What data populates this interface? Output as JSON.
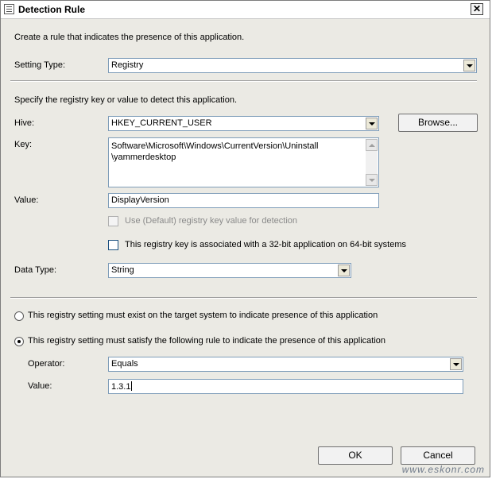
{
  "window": {
    "title": "Detection Rule"
  },
  "intro_text": "Create a rule that indicates the presence of this application.",
  "setting_type": {
    "label": "Setting Type:",
    "value": "Registry"
  },
  "registry": {
    "instruction": "Specify the registry key or value to detect this application.",
    "hive": {
      "label": "Hive:",
      "value": "HKEY_CURRENT_USER"
    },
    "browse_label": "Browse...",
    "key": {
      "label": "Key:",
      "value": "Software\\Microsoft\\Windows\\CurrentVersion\\Uninstall\n\\yammerdesktop"
    },
    "value": {
      "label": "Value:",
      "value": "DisplayVersion"
    },
    "use_default_label": "Use (Default) registry key value for detection",
    "is_32bit_label": "This registry key is associated with a 32-bit application on 64-bit systems",
    "data_type": {
      "label": "Data Type:",
      "value": "String"
    }
  },
  "options": {
    "must_exist_label": "This registry setting must exist on the target system to indicate presence of this application",
    "must_satisfy_label": "This registry setting must satisfy the following rule to indicate the presence of this application"
  },
  "rule": {
    "operator": {
      "label": "Operator:",
      "value": "Equals"
    },
    "value": {
      "label": "Value:",
      "value": "1.3.1"
    }
  },
  "buttons": {
    "ok": "OK",
    "cancel": "Cancel"
  },
  "watermark": "www.eskonr.com"
}
